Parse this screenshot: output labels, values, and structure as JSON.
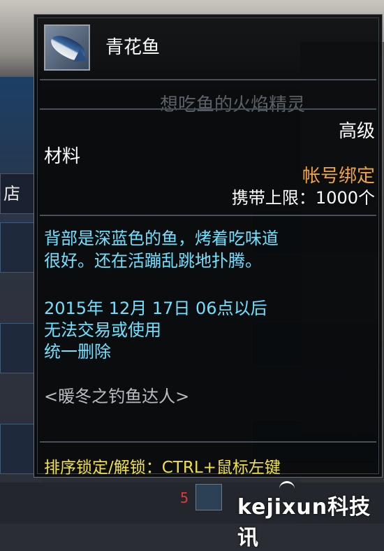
{
  "background": {
    "shop_tab_label": "店",
    "stack_count": "5",
    "watermark": "kejixun科技讯"
  },
  "tooltip": {
    "item_name": "青花鱼",
    "icon": "blue-fish-icon",
    "npc_name": "想吃鱼的火焰精灵",
    "grade": "高级",
    "item_type": "材料",
    "binding": "帐号绑定",
    "carry_limit": "携带上限：1000个",
    "description": [
      "背部是深蓝色的鱼，烤着吃味道",
      "很好。还在活蹦乱跳地扑腾。"
    ],
    "expiry": [
      "2015年 12月 17日 06点以后",
      "无法交易或使用",
      "统一删除"
    ],
    "source": "<暖冬之钓鱼达人>",
    "hint": "排序锁定/解锁：CTRL+鼠标左键"
  },
  "colors": {
    "description": "#6fe1ff",
    "binding": "#f0a43a",
    "hint": "#f2e23a",
    "count": "#e03a3a"
  }
}
